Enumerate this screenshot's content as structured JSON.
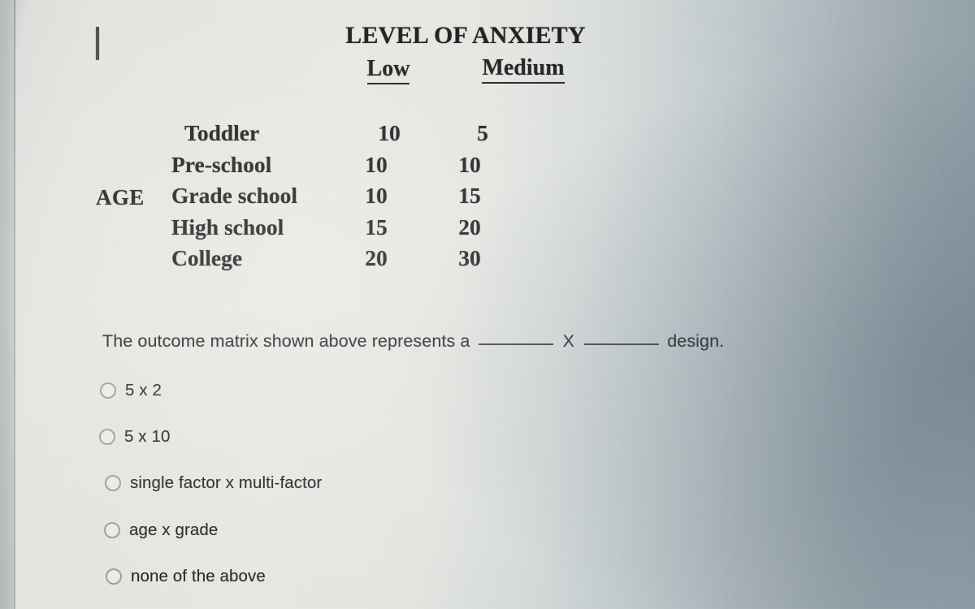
{
  "matrix": {
    "title": "LEVEL OF ANXIETY",
    "row_axis_label": "AGE",
    "column_headers": [
      "Low",
      "Medium"
    ],
    "rows": [
      {
        "label": "Toddler",
        "low": "10",
        "medium": "5"
      },
      {
        "label": "Pre-school",
        "low": "10",
        "medium": "10"
      },
      {
        "label": "Grade school",
        "low": "10",
        "medium": "15"
      },
      {
        "label": "High school",
        "low": "15",
        "medium": "20"
      },
      {
        "label": "College",
        "low": "20",
        "medium": "30"
      }
    ]
  },
  "question": {
    "lead_text": "The outcome matrix shown above represents a",
    "operator": "X",
    "trailing_text": "design."
  },
  "options": [
    {
      "label": "5 x 2",
      "selected": false
    },
    {
      "label": "5 x 10",
      "selected": false
    },
    {
      "label": "single factor x multi-factor",
      "selected": false
    },
    {
      "label": "age x grade",
      "selected": false
    },
    {
      "label": "none of the above",
      "selected": false
    }
  ],
  "colors": {
    "page_background_light": "#e5e6e0",
    "page_background_dark": "#93a0a9",
    "text": "#23262b",
    "matrix_text": "#171717",
    "radio_border": "#9a9d9c",
    "rule": "#9ba09e"
  }
}
